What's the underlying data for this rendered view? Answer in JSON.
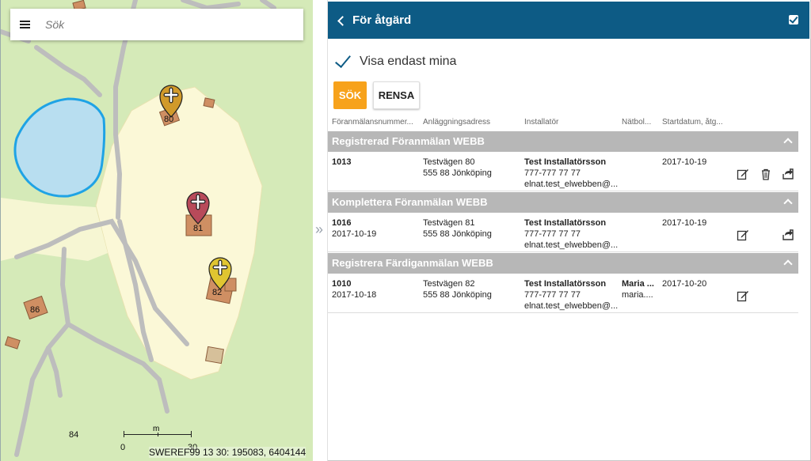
{
  "map": {
    "search": {
      "placeholder": "Sök"
    },
    "houses": [
      "80",
      "81",
      "82",
      "86",
      "84"
    ],
    "scale": {
      "unit": "m",
      "start": "0",
      "end": "30"
    },
    "coordinates": "SWEREF99 13 30: 195083, 6404144"
  },
  "panel": {
    "header": {
      "title": "För åtgärd"
    },
    "filter": {
      "label": "Visa endast mina"
    },
    "buttons": {
      "search": "SÖK",
      "clear": "RENSA"
    },
    "columns": [
      "Föranmälansnummer...",
      "Anläggningsadress",
      "Installatör",
      "Nätbol...",
      "Startdatum, åtg..."
    ],
    "groups": [
      {
        "title": "Registrerad Föranmälan WEBB",
        "rows": [
          {
            "number": "1013",
            "date": "",
            "address1": "Testvägen 80",
            "address2": "555 88 Jönköping",
            "installer_name": "Test Installatörsson",
            "installer_phone": "777-777 77 77",
            "installer_email": "elnat.test_elwebben@...",
            "netco1": "",
            "netco2": "",
            "start": "2017-10-19",
            "actions": [
              "edit-icon",
              "trash-icon",
              "forward-icon"
            ]
          }
        ]
      },
      {
        "title": "Komplettera Föranmälan WEBB",
        "rows": [
          {
            "number": "1016",
            "date": "2017-10-19",
            "address1": "Testvägen 81",
            "address2": "555 88 Jönköping",
            "installer_name": "Test Installatörsson",
            "installer_phone": "777-777 77 77",
            "installer_email": "elnat.test_elwebben@...",
            "netco1": "",
            "netco2": "",
            "start": "2017-10-19",
            "actions": [
              "edit-icon",
              "forward-icon"
            ]
          }
        ]
      },
      {
        "title": "Registrera Färdiganmälan WEBB",
        "rows": [
          {
            "number": "1010",
            "date": "2017-10-18",
            "address1": "Testvägen 82",
            "address2": "555 88 Jönköping",
            "installer_name": "Test Installatörsson",
            "installer_phone": "777-777 77 77",
            "installer_email": "elnat.test_elwebben@...",
            "netco1": "Maria ...",
            "netco2": "maria....",
            "start": "2017-10-20",
            "actions": [
              "edit-icon"
            ]
          }
        ]
      }
    ]
  },
  "colors": {
    "header": "#0d5b85",
    "accent": "#f7a21b",
    "group": "#b7b7b7",
    "marker80": "#d19a2a",
    "marker81": "#b84a5a",
    "marker82": "#e0c531",
    "lake": "#1fa3e5"
  }
}
